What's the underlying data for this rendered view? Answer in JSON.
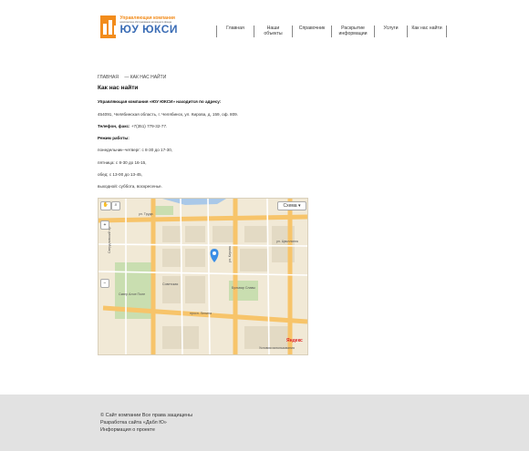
{
  "logo": {
    "top": "Управляющая компания",
    "sub": "комплексное обслуживание жилищного фонда",
    "main": "ЮУ ЮКСИ"
  },
  "nav": [
    {
      "label": "Главная"
    },
    {
      "label": "Наши объекты"
    },
    {
      "label": "Справочник"
    },
    {
      "label": "Раскрытие информации"
    },
    {
      "label": "Услуги"
    },
    {
      "label": "Как нас найти"
    }
  ],
  "breadcrumb": {
    "home": "ГЛАВНАЯ",
    "current": "— КАК НАС НАЙТИ"
  },
  "page": {
    "title": "Как нас найти",
    "intro": "Управляющая компания «ЮУ ЮКСИ» находится по адресу:",
    "address": "454091, Челябинская область, г. Челябинск, ул. Кирова, д. 159, оф. 809.",
    "phone_label": "Телефон, факс:",
    "phone": "+7(351) 779-32-77.",
    "hours_title": "Режим работы:",
    "hours": [
      "понедельник–четверг: с 8-30 до 17-30,",
      "пятница: с 8-30 до 16-15,",
      "обед: с 13-00 до 13-45,",
      "выходной: суббота, воскресенье."
    ]
  },
  "map": {
    "type_label": "Схема",
    "zoom_in": "+",
    "zoom_out": "−",
    "brand": "Яндекс",
    "terms": "Условия использования",
    "labels": {
      "trud": "ул. Труда",
      "komsomol": "Советская",
      "sverd": "Свердловский пр.",
      "lenina": "просп. Ленина",
      "kirova": "ул. Кирова",
      "tsvillinga": "ул. Цвиллинга",
      "alyy": "Сквер Алое Поле",
      "kvartal": "Бульвар Славы"
    }
  },
  "footer": {
    "line1": "© Сайт компании Все права защищены",
    "line2": "Разработка сайта «Дабл Ю»",
    "line3": "Информация о проекте"
  }
}
